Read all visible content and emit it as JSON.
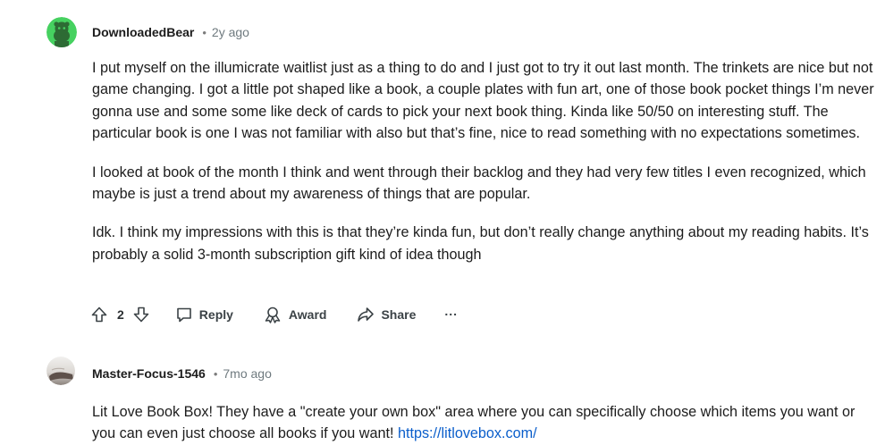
{
  "comments": [
    {
      "username": "DownloadedBear",
      "separator": "•",
      "time": "2y ago",
      "avatar": "snoo-avatar-green",
      "paragraphs": [
        "I put myself on the illumicrate waitlist just as a thing to do and I just got to try it out last month. The trinkets are nice but not game changing. I got a little pot shaped like a book, a couple plates with fun art, one of those book pocket things I’m never gonna use and some some like deck of cards to pick your next book thing. Kinda like 50/50 on interesting stuff. The particular book is one I was not familiar with also but that’s fine, nice to read something with no expectations sometimes.",
        "I looked at book of the month I think and went through their backlog and they had very few titles I even recognized, which maybe is just a trend about my awareness of things that are popular.",
        "Idk. I think my impressions with this is that they’re kinda fun, but don’t really change anything about my reading habits. It’s probably a solid 3-month subscription gift kind of idea though"
      ],
      "actions": {
        "score": "2",
        "reply_label": "Reply",
        "award_label": "Award",
        "share_label": "Share",
        "more_label": "..."
      }
    },
    {
      "username": "Master-Focus-1546",
      "separator": "•",
      "time": "7mo ago",
      "avatar": "photo-avatar",
      "text": "Lit Love Book Box! They have a \"create your own box\" area where you can specifically choose which items you want or you can even just choose all books if you want!",
      "link_text": "https://litlovebox.com/"
    }
  ],
  "colors": {
    "avatar_green": "#46d160",
    "link": "#0a5ecb",
    "meta_gray": "#6f7a7f"
  }
}
